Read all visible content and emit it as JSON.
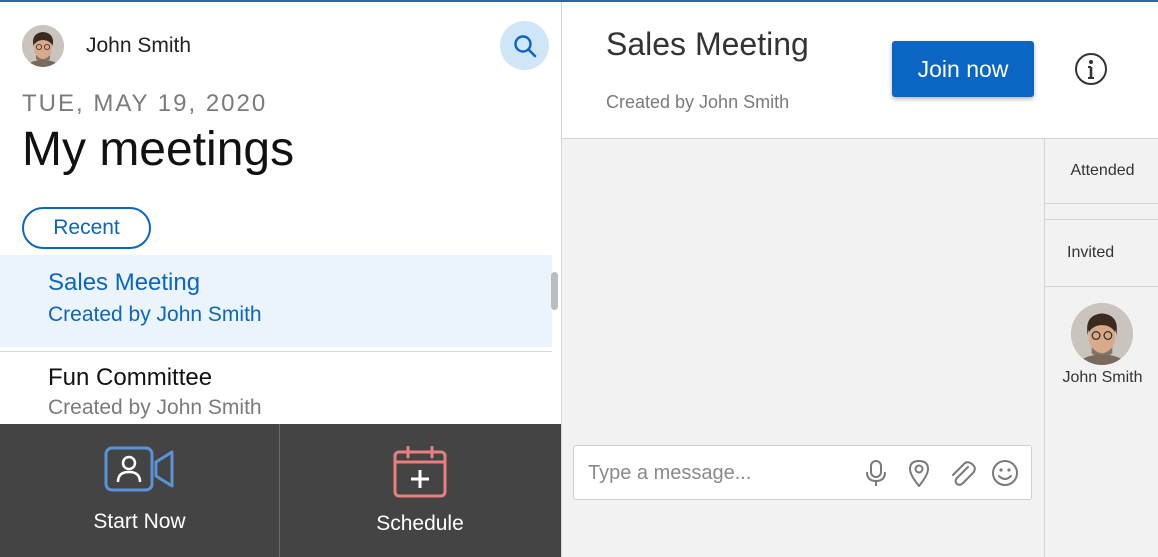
{
  "user": {
    "name": "John Smith"
  },
  "icons": {
    "search": "search-icon",
    "start": "video-camera-icon",
    "schedule": "calendar-add-icon",
    "info": "info-icon",
    "mic": "microphone-icon",
    "location": "location-pin-icon",
    "attach": "paperclip-icon",
    "emoji": "smiley-icon"
  },
  "header": {
    "date": "TUE, MAY 19, 2020",
    "title": "My meetings"
  },
  "filter": {
    "label": "Recent"
  },
  "meetings": [
    {
      "title": "Sales Meeting",
      "subtitle": "Created by John Smith"
    },
    {
      "title": "Fun Committee",
      "subtitle": "Created by John Smith"
    }
  ],
  "bottom_bar": {
    "start_label": "Start Now",
    "schedule_label": "Schedule"
  },
  "detail": {
    "title": "Sales Meeting",
    "subtitle": "Created by John Smith",
    "join_label": "Join now"
  },
  "composer": {
    "placeholder": "Type a message..."
  },
  "participants": {
    "attended_label": "Attended",
    "invited_label": "Invited",
    "invited": [
      {
        "name": "John Smith"
      }
    ]
  },
  "colors": {
    "accent": "#0a66c2",
    "selected_bg": "#ebf3fb",
    "bottom_bar": "#444444",
    "start_icon": "#5b94d6",
    "schedule_icon": "#e8817e"
  }
}
